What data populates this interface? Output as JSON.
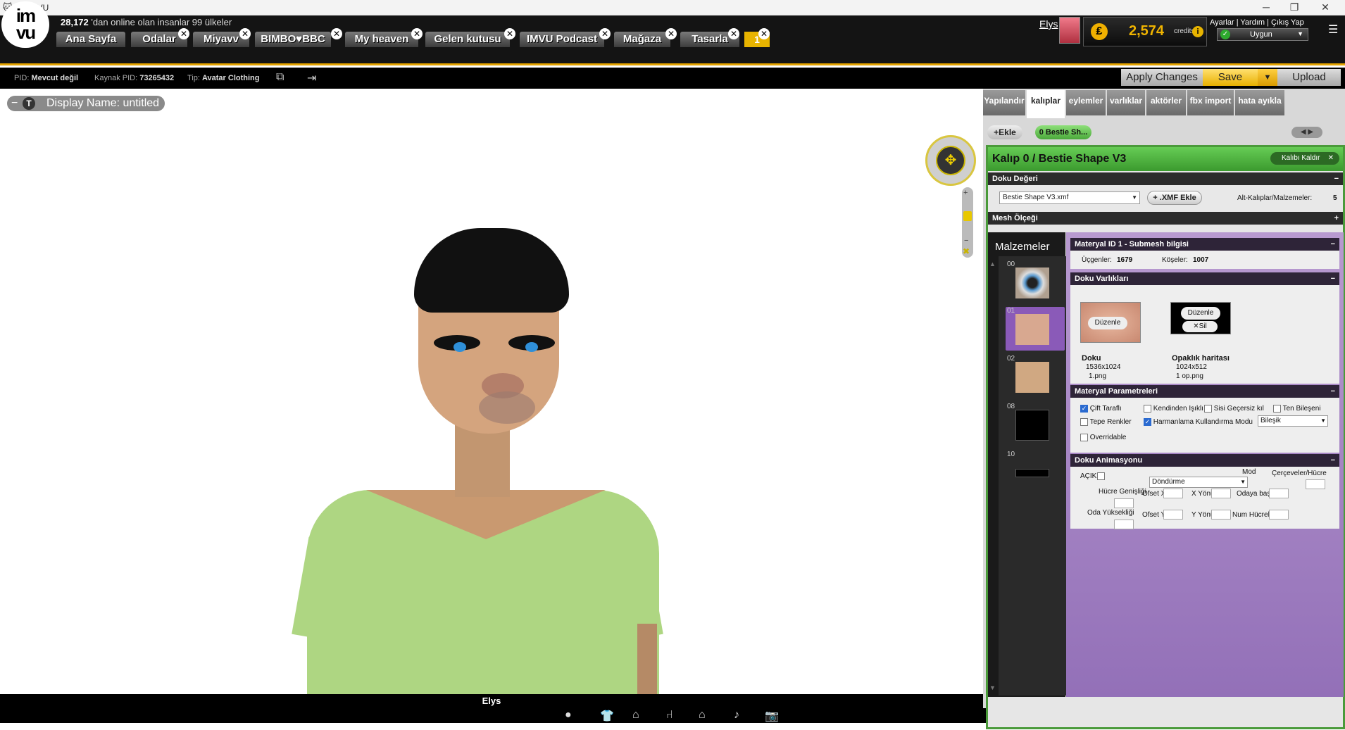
{
  "window": {
    "title": "1 - IMVU"
  },
  "header": {
    "logo": "imvu",
    "online_count": "28,172",
    "online_text": "'dan online olan insanlar 99 ülkeler",
    "tabs": [
      {
        "label": "Ana Sayfa"
      },
      {
        "label": "Odalar"
      },
      {
        "label": "Miyavv"
      },
      {
        "label": "BIMBO♥BBC"
      },
      {
        "label": "My heaven"
      },
      {
        "label": "Gelen kutusu"
      },
      {
        "label": "IMVU Podcast"
      },
      {
        "label": "Mağaza"
      },
      {
        "label": "Tasarla"
      }
    ],
    "active_tab_number": "1",
    "user_name": "Elys",
    "credits_value": "2,574",
    "credits_label": "credits",
    "links": "Ayarlar | Yardım | Çıkış Yap",
    "status": "Uygun"
  },
  "toolbar": {
    "pid_label": "PID:",
    "pid_value": "Mevcut değil",
    "source_pid_label": "Kaynak PID:",
    "source_pid_value": "73265432",
    "type_label": "Tip:",
    "type_value": "Avatar Clothing",
    "apply_label": "Apply Changes",
    "save_label": "Save",
    "upload_label": "Upload"
  },
  "viewport": {
    "display_name": "Display Name: untitled",
    "avatar_name": "Elys"
  },
  "panel": {
    "tabs": [
      "Yapılandır",
      "kalıplar",
      "eylemler",
      "varlıklar",
      "aktörler",
      "fbx import",
      "hata ayıkla"
    ],
    "active_tab": "kalıplar",
    "add_label": "Ekle",
    "pill_label": "0 Bestie Sh...",
    "title": "Kalıp 0 / Bestie Shape V3",
    "remove_label": "Kalıbı Kaldır",
    "texture_value_header": "Doku Değeri",
    "xmf_file": "Bestie Shape V3.xmf",
    "xmf_add_label": ".XMF Ekle",
    "submaterials_label": "Alt-Kalıplar/Malzemeler:",
    "submaterials_count": "5",
    "mesh_scale_header": "Mesh Ölçeği",
    "materials_label": "Malzemeler",
    "material_items": [
      {
        "num": "00",
        "color": "#5a9ad0"
      },
      {
        "num": "01",
        "color": "#d8a890"
      },
      {
        "num": "02",
        "color": "#d0a882"
      },
      {
        "num": "08",
        "color": "#000000"
      },
      {
        "num": "10",
        "color": "#000000"
      }
    ],
    "submesh_header": "Materyal ID 1 - Submesh bilgisi",
    "triangles_label": "Üçgenler:",
    "triangles_value": "1679",
    "vertices_label": "Köşeler:",
    "vertices_value": "1007",
    "texture_assets_header": "Doku Varlıkları",
    "edit_label": "Düzenle",
    "delete_label": "Sil",
    "texture_label": "Doku",
    "texture_size": "1536x1024",
    "texture_file": "1.png",
    "opacity_label": "Opaklık haritası",
    "opacity_size": "1024x512",
    "opacity_file": "1 op.png",
    "material_params_header": "Materyal Parametreleri",
    "params": {
      "double_sided": "Çift Taraflı",
      "self_lit": "Kendinden Işıklı",
      "fog_off": "Sisi Geçersiz kıl",
      "skin": "Ten Bileşeni",
      "vertex_colors": "Tepe Renkler",
      "blend_mode": "Harmanlama Kullandırma Modu",
      "blend_value": "Bileşik",
      "overridable": "Overridable"
    },
    "texture_anim_header": "Doku Animasyonu",
    "anim": {
      "open": "AÇIK",
      "mode": "Mod",
      "mode_value": "Döndürme",
      "frames_per_cell": "Çerçeveler/Hücre",
      "cell_width": "Hücre Genişliği",
      "offset_x": "Ofset X",
      "x_dir": "X Yönü",
      "start_room": "Odaya başla",
      "room_height": "Oda Yüksekliği",
      "offset_y": "Ofset Y",
      "y_dir": "Y Yönü",
      "num_cells": "Num Hücreler"
    }
  },
  "bottom": {
    "count": "9"
  },
  "colors": {
    "accent": "#e5a400",
    "green": "#4a9a3a",
    "purple": "#9d7cc0"
  }
}
